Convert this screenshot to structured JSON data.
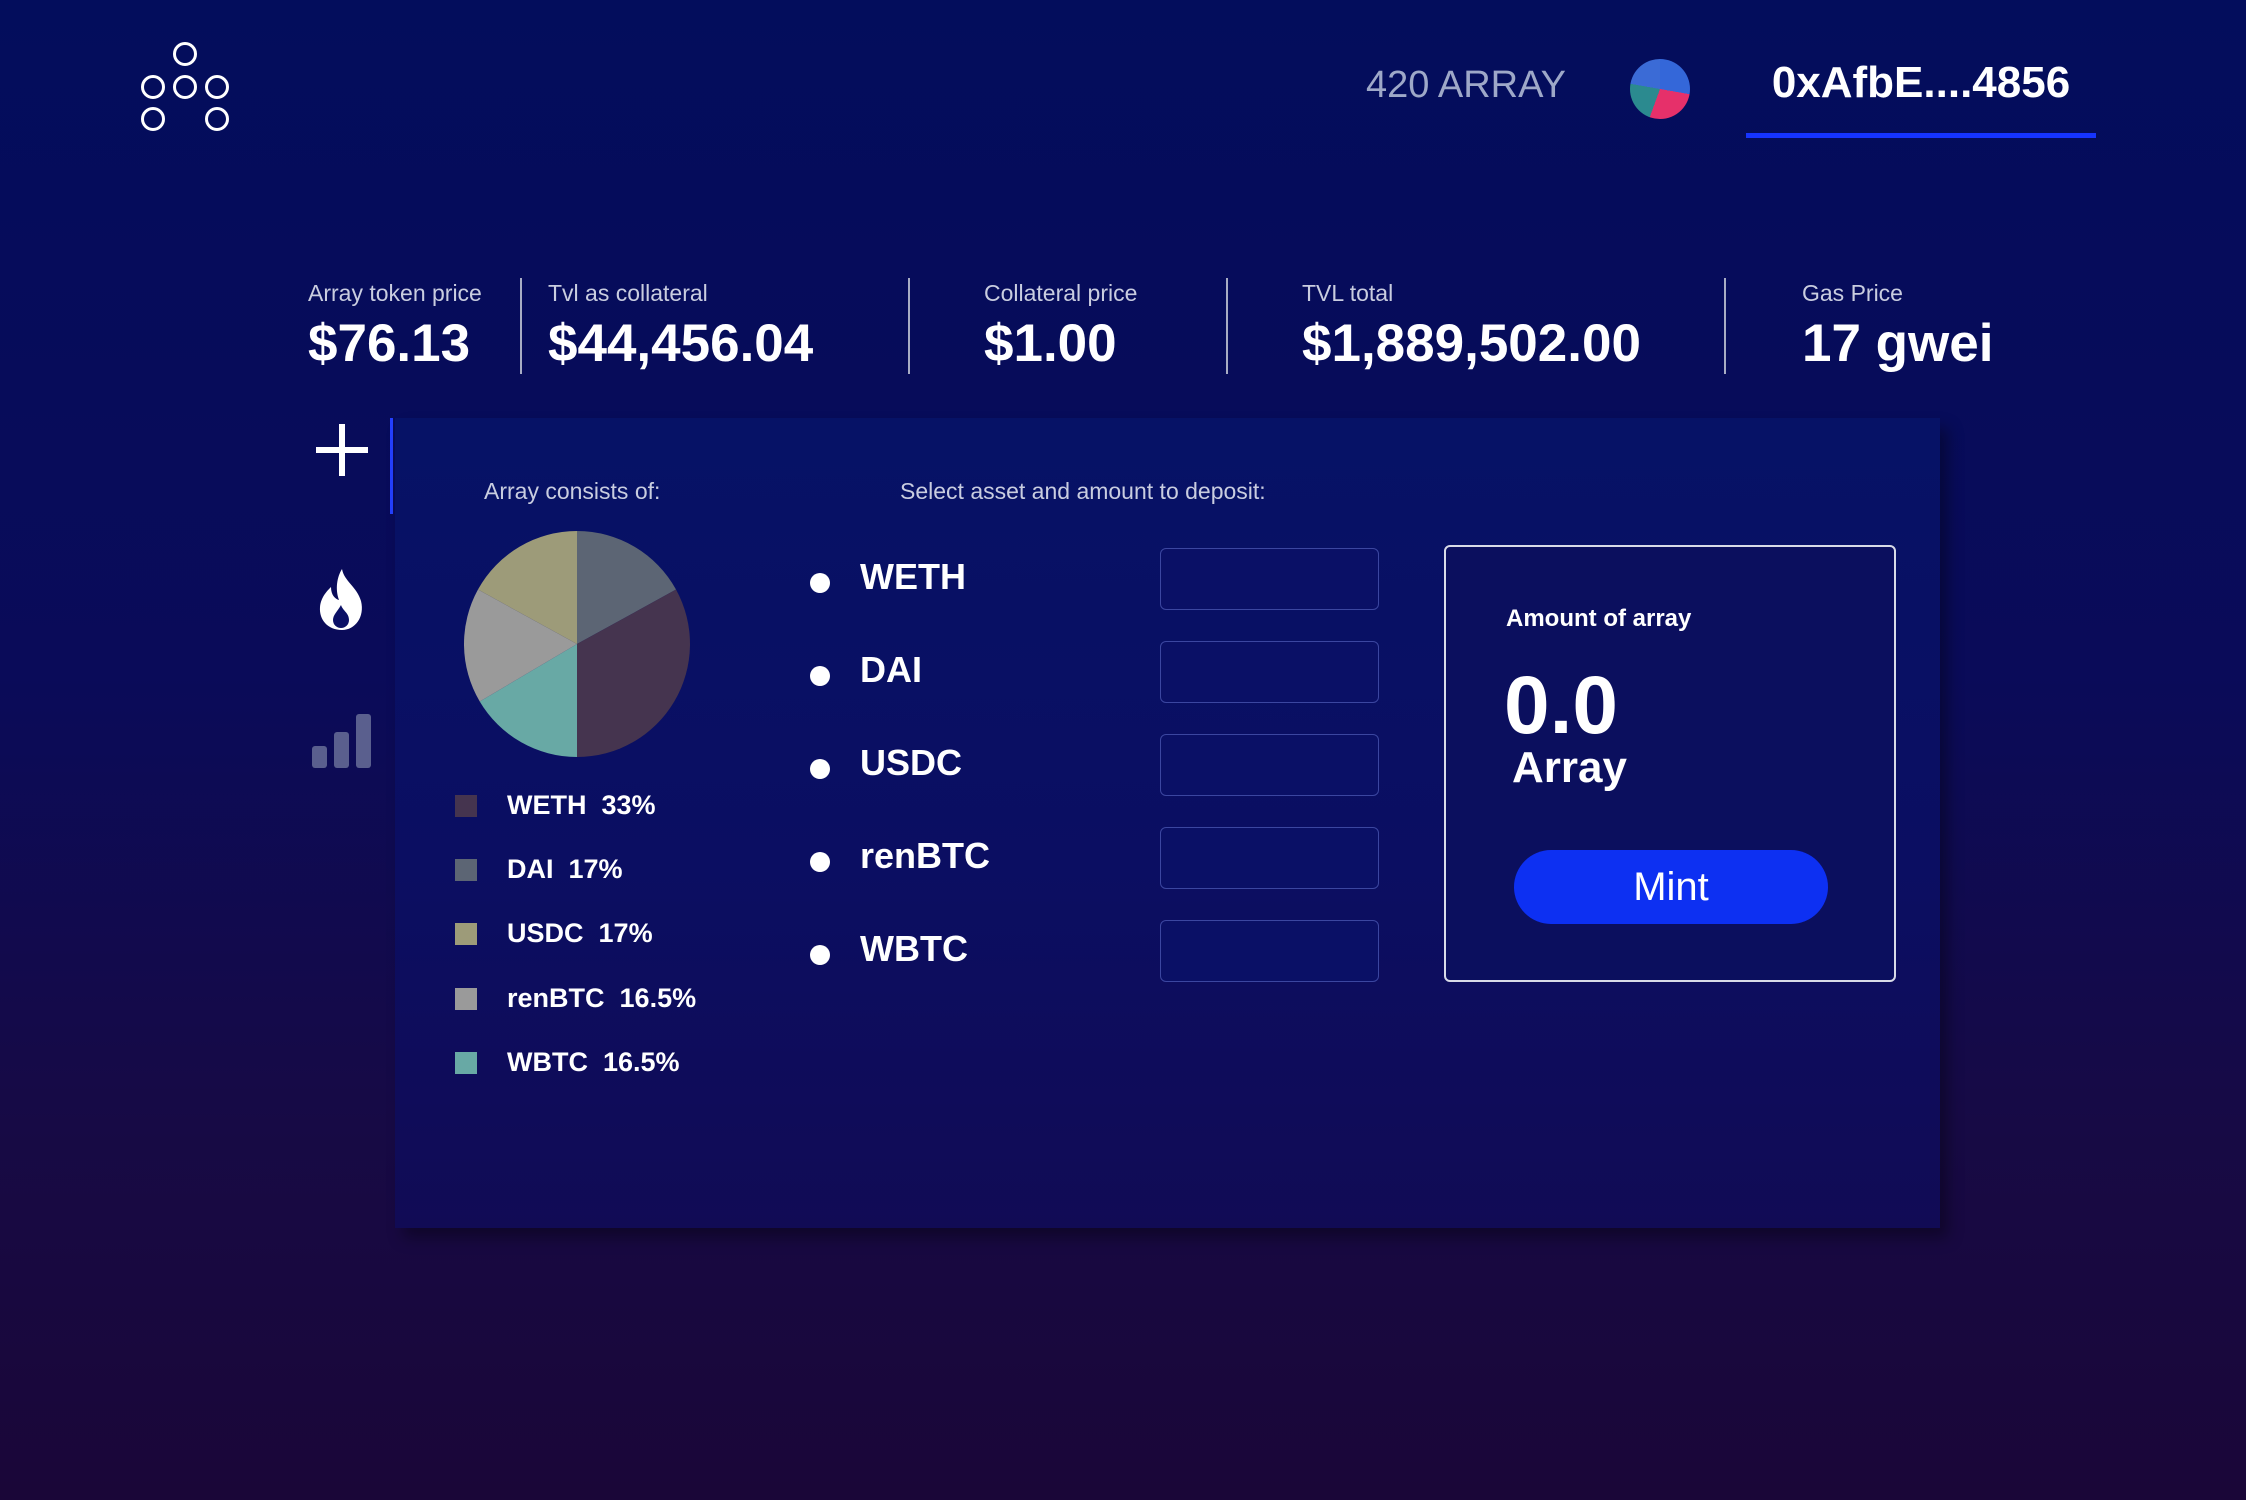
{
  "header": {
    "balance": "420 ARRAY",
    "address": "0xAfbE....4856"
  },
  "stats": [
    {
      "label": "Array token price",
      "value": "$76.13"
    },
    {
      "label": "Tvl as collateral",
      "value": "$44,456.04"
    },
    {
      "label": "Collateral price",
      "value": "$1.00"
    },
    {
      "label": "TVL total",
      "value": "$1,889,502.00"
    },
    {
      "label": "Gas Price",
      "value": "17 gwei"
    }
  ],
  "sidebar": {
    "items": [
      {
        "icon": "plus-icon",
        "active": true
      },
      {
        "icon": "fire-icon",
        "active": false
      },
      {
        "icon": "bar-chart-icon",
        "active": false
      }
    ]
  },
  "composition": {
    "label": "Array consists of:",
    "items": [
      {
        "name": "WETH",
        "percent": "33%",
        "value": 33,
        "color": "#45344f"
      },
      {
        "name": "DAI",
        "percent": "17%",
        "value": 17,
        "color": "#5c6574"
      },
      {
        "name": "USDC",
        "percent": "17%",
        "value": 17,
        "color": "#9d9b79"
      },
      {
        "name": "renBTC",
        "percent": "16.5%",
        "value": 16.5,
        "color": "#9a9a9a"
      },
      {
        "name": "WBTC",
        "percent": "16.5%",
        "value": 16.5,
        "color": "#68a9a5"
      }
    ]
  },
  "deposit": {
    "label": "Select asset and amount to deposit:",
    "assets": [
      {
        "name": "WETH",
        "value": ""
      },
      {
        "name": "DAI",
        "value": ""
      },
      {
        "name": "USDC",
        "value": ""
      },
      {
        "name": "renBTC",
        "value": ""
      },
      {
        "name": "WBTC",
        "value": ""
      }
    ]
  },
  "mint": {
    "title": "Amount of array",
    "amount": "0.0",
    "unit": "Array",
    "button_label": "Mint"
  },
  "colors": {
    "accent": "#0d30f2",
    "background": "#030d5c"
  }
}
